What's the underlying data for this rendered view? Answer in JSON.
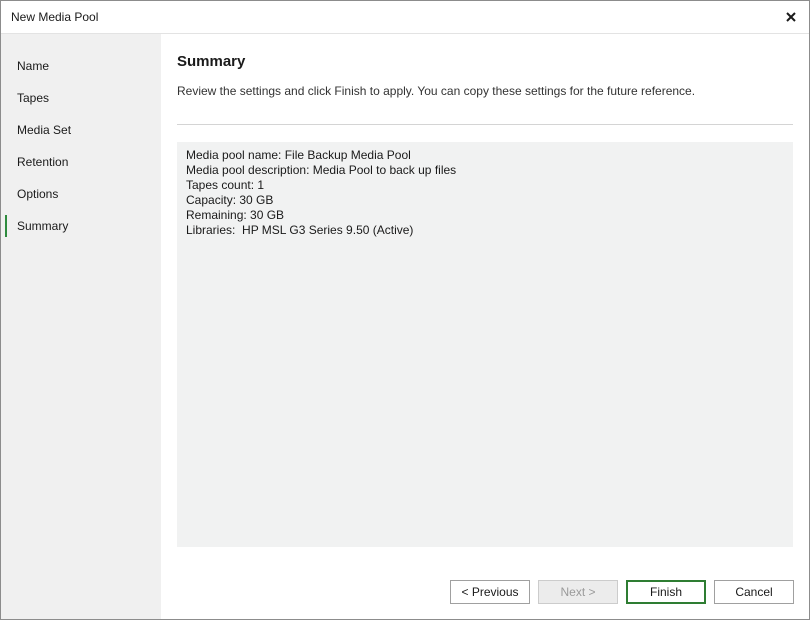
{
  "window": {
    "title": "New Media Pool",
    "close_icon": "close-icon"
  },
  "sidebar": {
    "items": [
      {
        "label": "Name",
        "active": false
      },
      {
        "label": "Tapes",
        "active": false
      },
      {
        "label": "Media Set",
        "active": false
      },
      {
        "label": "Retention",
        "active": false
      },
      {
        "label": "Options",
        "active": false
      },
      {
        "label": "Summary",
        "active": true
      }
    ]
  },
  "main": {
    "heading": "Summary",
    "subtitle": "Review the settings and click Finish to apply. You can copy these settings for the future reference.",
    "summary_lines": [
      "Media pool name: File Backup Media Pool",
      "Media pool description: Media Pool to back up files",
      "Tapes count: 1",
      "Capacity: 30 GB",
      "Remaining: 30 GB",
      "Libraries:  HP MSL G3 Series 9.50 (Active)"
    ]
  },
  "buttons": {
    "previous": "< Previous",
    "next": "Next >",
    "finish": "Finish",
    "cancel": "Cancel"
  },
  "colors": {
    "accent": "#2e8b3e",
    "sidebar_bg": "#f0f0f0",
    "summary_bg": "#f1f2f2"
  }
}
